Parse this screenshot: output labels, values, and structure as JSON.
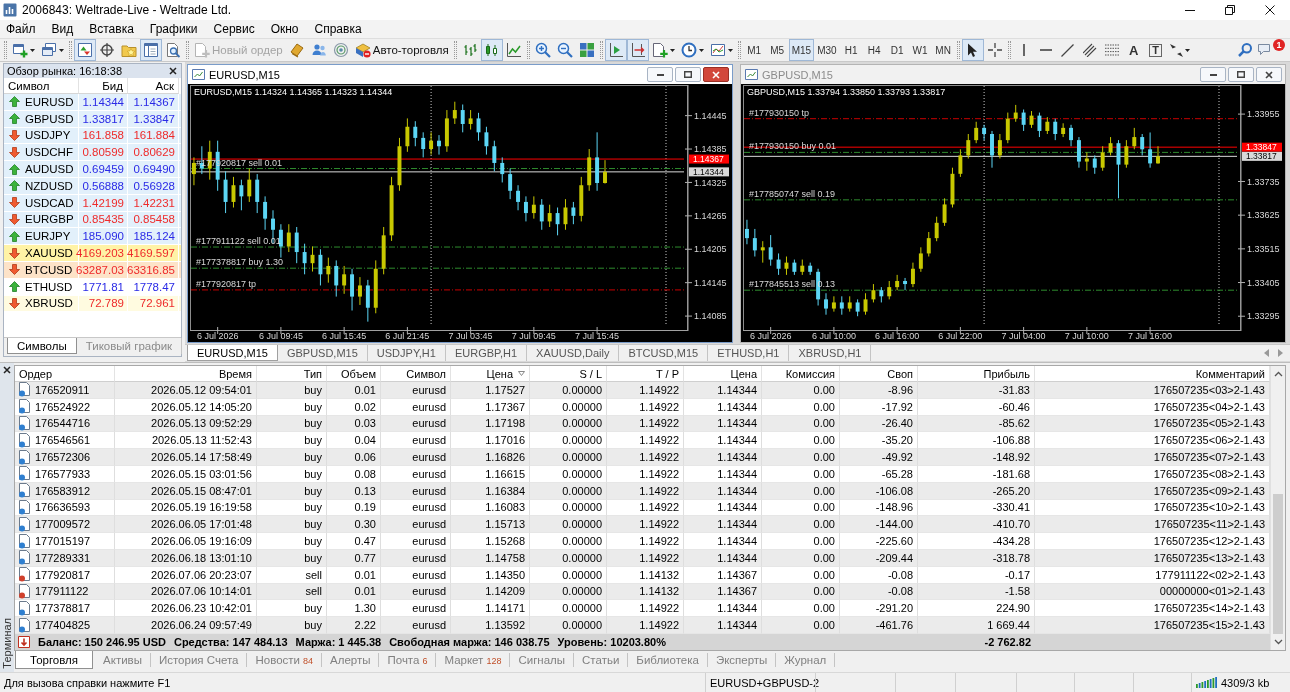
{
  "window": {
    "title": "2006843: Weltrade-Live - Weltrade Ltd."
  },
  "menu": [
    "Файл",
    "Вид",
    "Вставка",
    "Графики",
    "Сервис",
    "Окно",
    "Справка"
  ],
  "toolbar": {
    "panel_buttons": [
      {
        "pressed": true
      },
      {
        "pressed": false
      },
      {
        "pressed": false
      },
      {
        "pressed": true
      },
      {
        "pressed": false
      }
    ],
    "new_order": {
      "label": "Новый ордер",
      "disabled": true
    },
    "auto_trading": {
      "label": "Авто-торговля"
    },
    "chart_types": [
      {
        "selected": false
      },
      {
        "selected": true
      },
      {
        "selected": false
      }
    ],
    "chart_toggles": [
      {
        "pressed": true
      },
      {
        "pressed": true
      }
    ],
    "timeframes": [
      {
        "label": "M1",
        "selected": false
      },
      {
        "label": "M5",
        "selected": false
      },
      {
        "label": "M15",
        "selected": true
      },
      {
        "label": "M30",
        "selected": false
      },
      {
        "label": "H1",
        "selected": false
      },
      {
        "label": "H4",
        "selected": false
      },
      {
        "label": "D1",
        "selected": false
      },
      {
        "label": "W1",
        "selected": false
      },
      {
        "label": "MN",
        "selected": false
      }
    ],
    "cursor_tools": [
      {
        "selected": true
      },
      {
        "selected": false
      }
    ],
    "text_tools": [
      "A",
      "T"
    ],
    "notification_badge": "1"
  },
  "market_watch": {
    "title": "Обзор рынка: 16:18:38",
    "columns": [
      "Символ",
      "Бид",
      "Аск"
    ],
    "rows": [
      {
        "symbol": "EURUSD",
        "bid": "1.14344",
        "ask": "1.14367",
        "rising": true,
        "color": "#e2f0fb"
      },
      {
        "symbol": "GBPUSD",
        "bid": "1.33817",
        "ask": "1.33847",
        "rising": true,
        "color": "#e2f0fb"
      },
      {
        "symbol": "USDJPY",
        "bid": "161.858",
        "ask": "161.884",
        "rising": false,
        "color": "#e2f0fb"
      },
      {
        "symbol": "USDCHF",
        "bid": "0.80599",
        "ask": "0.80629",
        "rising": false,
        "color": "#e2f0fb"
      },
      {
        "symbol": "AUDUSD",
        "bid": "0.69459",
        "ask": "0.69490",
        "rising": true,
        "color": "#e2f0fb"
      },
      {
        "symbol": "NZDUSD",
        "bid": "0.56888",
        "ask": "0.56928",
        "rising": true,
        "color": "#e2f0fb"
      },
      {
        "symbol": "USDCAD",
        "bid": "1.42199",
        "ask": "1.42231",
        "rising": false,
        "color": "#e2f0fb"
      },
      {
        "symbol": "EURGBP",
        "bid": "0.85435",
        "ask": "0.85458",
        "rising": false,
        "color": "#e2f0fb"
      },
      {
        "symbol": "EURJPY",
        "bid": "185.090",
        "ask": "185.124",
        "rising": true,
        "color": "#e2f0fb"
      },
      {
        "symbol": "XAUUSD",
        "bid": "4169.203",
        "ask": "4169.597",
        "rising": false,
        "color": "#fff3a6"
      },
      {
        "symbol": "BTCUSD",
        "bid": "63287.03",
        "ask": "63316.85",
        "rising": false,
        "color": "#fde3c8"
      },
      {
        "symbol": "ETHUSD",
        "bid": "1771.81",
        "ask": "1778.47",
        "rising": true,
        "color": "#ffffff"
      },
      {
        "symbol": "XBRUSD",
        "bid": "72.789",
        "ask": "72.961",
        "rising": false,
        "color": "#fffbe0"
      }
    ],
    "tabs": [
      {
        "label": "Символы",
        "selected": true
      },
      {
        "label": "Тиковый график",
        "selected": false
      }
    ]
  },
  "charts": [
    {
      "title": "EURUSD,M15",
      "active": true,
      "chart_data": [
        {
          "type": "candlestick",
          "title": "EURUSD,M15 1.14324 1.14365 1.14323 1.14344",
          "categories": [
            null,
            null,
            null,
            "6 Jul 2026",
            null,
            null,
            null,
            null,
            null,
            null,
            null,
            "6 Jul 09:45",
            null,
            null,
            null,
            null,
            null,
            null,
            null,
            "6 Jul 15:45",
            null,
            null,
            null,
            null,
            null,
            null,
            null,
            "6 Jul 21:45",
            null,
            null,
            null,
            null,
            null,
            null,
            null,
            "7 Jul 03:45",
            null,
            null,
            null,
            null,
            null,
            null,
            null,
            "7 Jul 09:45",
            null,
            null,
            null,
            null,
            null,
            null,
            null,
            "7 Jul 15:45",
            null,
            null,
            null,
            null,
            null,
            null,
            null,
            null,
            null,
            null,
            null
          ],
          "ylim": [
            1.1406,
            1.145
          ],
          "yticks": [
            {
              "value": 1.14085,
              "label": "1.14085"
            },
            {
              "value": 1.14145,
              "label": "1.14145"
            },
            {
              "value": 1.14205,
              "label": "1.14205"
            },
            {
              "value": 1.14265,
              "label": "1.14265"
            },
            {
              "value": 1.14325,
              "label": "1.14325"
            },
            {
              "value": 1.14385,
              "label": "1.14385"
            },
            {
              "value": 1.14445,
              "label": "1.14445"
            }
          ],
          "ohlc": [
            [
              1.1434,
              1.1437,
              1.1432,
              1.1436
            ],
            [
              1.1436,
              1.1439,
              1.1434,
              1.1435
            ],
            [
              1.1435,
              1.144,
              1.1433,
              1.1438
            ],
            [
              1.1438,
              1.144,
              1.1431,
              1.1433
            ],
            [
              1.1433,
              1.14345,
              1.1427,
              1.1429
            ],
            [
              1.1429,
              1.14335,
              1.1428,
              1.1432
            ],
            [
              1.1432,
              1.1433,
              1.14275,
              1.143
            ],
            [
              1.143,
              1.1435,
              1.1429,
              1.1433
            ],
            [
              1.1433,
              1.1434,
              1.1427,
              1.1429
            ],
            [
              1.1429,
              1.143,
              1.1424,
              1.1426
            ],
            [
              1.1426,
              1.14275,
              1.14215,
              1.1424
            ],
            [
              1.1424,
              1.1425,
              1.1419,
              1.1421
            ],
            [
              1.1421,
              1.1425,
              1.142,
              1.14235
            ],
            [
              1.14235,
              1.14245,
              1.1418,
              1.142
            ],
            [
              1.142,
              1.14215,
              1.1416,
              1.1418
            ],
            [
              1.1418,
              1.1421,
              1.14165,
              1.14195
            ],
            [
              1.14195,
              1.14205,
              1.1414,
              1.1416
            ],
            [
              1.1416,
              1.1419,
              1.14145,
              1.14175
            ],
            [
              1.14175,
              1.14185,
              1.1412,
              1.1414
            ],
            [
              1.1414,
              1.14175,
              1.14125,
              1.1416
            ],
            [
              1.1416,
              1.1417,
              1.14095,
              1.1412
            ],
            [
              1.1412,
              1.14155,
              1.14105,
              1.1414
            ],
            [
              1.1414,
              1.1415,
              1.14075,
              1.141
            ],
            [
              1.141,
              1.14185,
              1.1409,
              1.1417
            ],
            [
              1.1417,
              1.14245,
              1.1416,
              1.1423
            ],
            [
              1.1423,
              1.14335,
              1.1422,
              1.1432
            ],
            [
              1.1432,
              1.14405,
              1.1431,
              1.1439
            ],
            [
              1.1439,
              1.1444,
              1.1438,
              1.14425
            ],
            [
              1.14425,
              1.14435,
              1.1439,
              1.14405
            ],
            [
              1.14405,
              1.14415,
              1.1437,
              1.14385
            ],
            [
              1.14385,
              1.14415,
              1.14375,
              1.144
            ],
            [
              1.144,
              1.1441,
              1.14375,
              1.1439
            ],
            [
              1.1439,
              1.14455,
              1.1438,
              1.1444
            ],
            [
              1.1444,
              1.1447,
              1.1443,
              1.14455
            ],
            [
              1.14455,
              1.14465,
              1.14415,
              1.1443
            ],
            [
              1.1443,
              1.14455,
              1.1442,
              1.1444
            ],
            [
              1.1444,
              1.1445,
              1.144,
              1.14415
            ],
            [
              1.14415,
              1.14425,
              1.14375,
              1.1439
            ],
            [
              1.1439,
              1.144,
              1.14345,
              1.1436
            ],
            [
              1.1436,
              1.1437,
              1.14325,
              1.1434
            ],
            [
              1.1434,
              1.1435,
              1.14295,
              1.1431
            ],
            [
              1.1431,
              1.1432,
              1.14275,
              1.1429
            ],
            [
              1.1429,
              1.143,
              1.14255,
              1.1427
            ],
            [
              1.1427,
              1.143,
              1.1426,
              1.14285
            ],
            [
              1.14285,
              1.14295,
              1.1424,
              1.14255
            ],
            [
              1.14255,
              1.14285,
              1.14245,
              1.1427
            ],
            [
              1.1427,
              1.1428,
              1.1423,
              1.1425
            ],
            [
              1.1425,
              1.14295,
              1.1424,
              1.1428
            ],
            [
              1.1428,
              1.1429,
              1.1425,
              1.14265
            ],
            [
              1.14265,
              1.14335,
              1.14255,
              1.1432
            ],
            [
              1.1432,
              1.14385,
              1.1431,
              1.1437
            ],
            [
              1.1437,
              1.14415,
              1.1431,
              1.14324
            ],
            [
              1.14324,
              1.14365,
              1.14323,
              1.14344
            ],
            null,
            null,
            null,
            null,
            null,
            null,
            null,
            null,
            null,
            null
          ],
          "ref_lines": [
            {
              "axis": "y",
              "value": 1.14367,
              "label": "1.14367",
              "color": "#ff0000",
              "line_style": "solid"
            },
            {
              "axis": "y",
              "value": 1.14344,
              "label": "1.14344",
              "color": "#d9d9d9",
              "line_style": "solid"
            },
            {
              "axis": "y",
              "value": 1.1435,
              "label": "#177920817 sell 0.01",
              "color": "#2e8b2e",
              "line_style": "dashdot"
            },
            {
              "axis": "y",
              "value": 1.14209,
              "label": "#177911122 sell 0.01",
              "color": "#2e8b2e",
              "line_style": "dashdot"
            },
            {
              "axis": "y",
              "value": 1.14171,
              "label": "#177378817 buy 1.30",
              "color": "#2e8b2e",
              "line_style": "dashdot"
            },
            {
              "axis": "y",
              "value": 1.14132,
              "label": "#177920817 tp",
              "color": "#c80000",
              "line_style": "dashdot"
            }
          ]
        }
      ]
    },
    {
      "title": "GBPUSD,M15",
      "active": false,
      "chart_data": [
        {
          "type": "candlestick",
          "title": "GBPUSD,M15 1.33794 1.33850 1.33793 1.33817",
          "categories": [
            null,
            null,
            null,
            "6 Jul 2026",
            null,
            null,
            null,
            null,
            null,
            null,
            null,
            "6 Jul 10:00",
            null,
            null,
            null,
            null,
            null,
            null,
            null,
            "6 Jul 16:00",
            null,
            null,
            null,
            null,
            null,
            null,
            null,
            "6 Jul 22:00",
            null,
            null,
            null,
            null,
            null,
            null,
            null,
            "7 Jul 04:00",
            null,
            null,
            null,
            null,
            null,
            null,
            null,
            "7 Jul 10:00",
            null,
            null,
            null,
            null,
            null,
            null,
            null,
            "7 Jul 16:00",
            null,
            null,
            null,
            null,
            null,
            null,
            null,
            null,
            null,
            null,
            null
          ],
          "ylim": [
            1.3325,
            1.3405
          ],
          "yticks": [
            {
              "value": 1.33295,
              "label": "1.33295"
            },
            {
              "value": 1.33405,
              "label": "1.33405"
            },
            {
              "value": 1.33515,
              "label": "1.33515"
            },
            {
              "value": 1.33625,
              "label": "1.33625"
            },
            {
              "value": 1.33735,
              "label": "1.33735"
            },
            {
              "value": 1.33955,
              "label": "1.33955"
            }
          ],
          "ohlc": [
            [
              1.3358,
              1.3361,
              1.3353,
              1.3355
            ],
            [
              1.3355,
              1.3358,
              1.3349,
              1.3351
            ],
            [
              1.3351,
              1.3354,
              1.3347,
              1.3352
            ],
            [
              1.3352,
              1.3356,
              1.3346,
              1.3348
            ],
            [
              1.3348,
              1.335,
              1.3343,
              1.3345
            ],
            [
              1.3345,
              1.3349,
              1.3343,
              1.3347
            ],
            [
              1.3347,
              1.3348,
              1.3343,
              1.3344
            ],
            [
              1.3344,
              1.3348,
              1.3343,
              1.3346
            ],
            [
              1.3346,
              1.3347,
              1.3343,
              1.3344
            ],
            [
              1.3344,
              1.3345,
              1.3333,
              1.3335
            ],
            [
              1.3335,
              1.3337,
              1.333,
              1.3332
            ],
            [
              1.3332,
              1.3336,
              1.3331,
              1.3334
            ],
            [
              1.3334,
              1.3336,
              1.333,
              1.3332
            ],
            [
              1.3332,
              1.3336,
              1.3331,
              1.3334
            ],
            [
              1.3334,
              1.3335,
              1.33295,
              1.3331
            ],
            [
              1.3331,
              1.3337,
              1.333,
              1.3335
            ],
            [
              1.3335,
              1.334,
              1.3334,
              1.3338
            ],
            [
              1.3338,
              1.3339,
              1.3334,
              1.3336
            ],
            [
              1.3336,
              1.3341,
              1.3335,
              1.3339
            ],
            [
              1.3339,
              1.3343,
              1.3338,
              1.3341
            ],
            [
              1.3341,
              1.3342,
              1.3338,
              1.334
            ],
            [
              1.334,
              1.3347,
              1.3339,
              1.3345
            ],
            [
              1.3345,
              1.3352,
              1.3344,
              1.335
            ],
            [
              1.335,
              1.3357,
              1.3349,
              1.3355
            ],
            [
              1.3355,
              1.3362,
              1.3354,
              1.336
            ],
            [
              1.336,
              1.3368,
              1.3359,
              1.3366
            ],
            [
              1.3366,
              1.3378,
              1.3365,
              1.3376
            ],
            [
              1.3376,
              1.3384,
              1.3375,
              1.3382
            ],
            [
              1.3382,
              1.3389,
              1.3381,
              1.3387
            ],
            [
              1.3387,
              1.3393,
              1.3386,
              1.3391
            ],
            [
              1.3391,
              1.3392,
              1.3387,
              1.3389
            ],
            [
              1.3389,
              1.339,
              1.3378,
              1.3382
            ],
            [
              1.3382,
              1.3389,
              1.3381,
              1.3387
            ],
            [
              1.3387,
              1.3396,
              1.3386,
              1.3394
            ],
            [
              1.3394,
              1.33985,
              1.3393,
              1.3396
            ],
            [
              1.3396,
              1.3397,
              1.339,
              1.3392
            ],
            [
              1.3392,
              1.33965,
              1.3391,
              1.3395
            ],
            [
              1.3395,
              1.3396,
              1.3388,
              1.339
            ],
            [
              1.339,
              1.33945,
              1.3389,
              1.3393
            ],
            [
              1.3393,
              1.3394,
              1.3387,
              1.3389
            ],
            [
              1.3389,
              1.33925,
              1.3388,
              1.3391
            ],
            [
              1.3391,
              1.3392,
              1.3385,
              1.3387
            ],
            [
              1.3387,
              1.3388,
              1.3378,
              1.338
            ],
            [
              1.338,
              1.3383,
              1.3377,
              1.3381
            ],
            [
              1.3381,
              1.3382,
              1.3376,
              1.3378
            ],
            [
              1.3378,
              1.3385,
              1.3377,
              1.3383
            ],
            [
              1.3383,
              1.3388,
              1.3382,
              1.3386
            ],
            [
              1.3386,
              1.3387,
              1.3368,
              1.3379
            ],
            [
              1.3379,
              1.3387,
              1.3378,
              1.3385
            ],
            [
              1.3385,
              1.3391,
              1.3384,
              1.3388
            ],
            [
              1.3388,
              1.3389,
              1.3382,
              1.3384
            ],
            [
              1.3384,
              1.33895,
              1.3378,
              1.33794
            ],
            [
              1.33794,
              1.3385,
              1.33793,
              1.33817
            ],
            null,
            null,
            null,
            null,
            null,
            null,
            null,
            null,
            null,
            null
          ],
          "ref_lines": [
            {
              "axis": "y",
              "value": 1.33847,
              "label": "1.33847",
              "color": "#ff0000",
              "line_style": "solid"
            },
            {
              "axis": "y",
              "value": 1.33817,
              "label": "1.33817",
              "color": "#d9d9d9",
              "line_style": "solid"
            },
            {
              "axis": "y",
              "value": 1.3394,
              "label": "#177930150 tp",
              "color": "#c80000",
              "line_style": "dashdot"
            },
            {
              "axis": "y",
              "value": 1.3383,
              "label": "#177930150 buy 0.01",
              "color": "#2e8b2e",
              "line_style": "dashdot"
            },
            {
              "axis": "y",
              "value": 1.33675,
              "label": "#177850747 sell 0.19",
              "color": "#2e8b2e",
              "line_style": "dashdot"
            },
            {
              "axis": "y",
              "value": 1.3338,
              "label": "#177845513 sell 0.13",
              "color": "#2e8b2e",
              "line_style": "dashdot"
            }
          ]
        }
      ]
    }
  ],
  "chart_tabs": [
    {
      "label": "EURUSD,M15",
      "selected": true
    },
    {
      "label": "GBPUSD,M15",
      "selected": false
    },
    {
      "label": "USDJPY,H1",
      "selected": false
    },
    {
      "label": "EURGBP,H1",
      "selected": false
    },
    {
      "label": "XAUUSD,Daily",
      "selected": false
    },
    {
      "label": "BTCUSD,M15",
      "selected": false
    },
    {
      "label": "ETHUSD,H1",
      "selected": false
    },
    {
      "label": "XBRUSD,H1",
      "selected": false
    }
  ],
  "terminal": {
    "side_label": "Терминал",
    "columns": [
      {
        "label": "Ордер",
        "sorted": false
      },
      {
        "label": "Время",
        "sorted": false
      },
      {
        "label": "Тип",
        "sorted": false
      },
      {
        "label": "Объем",
        "sorted": false
      },
      {
        "label": "Символ",
        "sorted": false
      },
      {
        "label": "Цена",
        "sorted": true
      },
      {
        "label": "S / L",
        "sorted": false
      },
      {
        "label": "T / P",
        "sorted": false
      },
      {
        "label": "Цена",
        "sorted": false
      },
      {
        "label": "Комиссия",
        "sorted": false
      },
      {
        "label": "Своп",
        "sorted": false
      },
      {
        "label": "Прибыль",
        "sorted": false
      },
      {
        "label": "Комментарий",
        "sorted": false
      }
    ],
    "rows": [
      {
        "kind": "buy",
        "cells": [
          "176520911",
          "2026.05.12 09:54:01",
          "buy",
          "0.01",
          "eurusd",
          "1.17527",
          "0.00000",
          "1.14922",
          "1.14344",
          "0.00",
          "-8.96",
          "-31.83",
          "176507235<03>2-1.43"
        ]
      },
      {
        "kind": "buy",
        "cells": [
          "176524922",
          "2026.05.12 14:05:20",
          "buy",
          "0.02",
          "eurusd",
          "1.17367",
          "0.00000",
          "1.14922",
          "1.14344",
          "0.00",
          "-17.92",
          "-60.46",
          "176507235<04>2-1.43"
        ]
      },
      {
        "kind": "buy",
        "cells": [
          "176544716",
          "2026.05.13 09:52:29",
          "buy",
          "0.03",
          "eurusd",
          "1.17198",
          "0.00000",
          "1.14922",
          "1.14344",
          "0.00",
          "-26.40",
          "-85.62",
          "176507235<05>2-1.43"
        ]
      },
      {
        "kind": "buy",
        "cells": [
          "176546561",
          "2026.05.13 11:52:43",
          "buy",
          "0.04",
          "eurusd",
          "1.17016",
          "0.00000",
          "1.14922",
          "1.14344",
          "0.00",
          "-35.20",
          "-106.88",
          "176507235<06>2-1.43"
        ]
      },
      {
        "kind": "buy",
        "cells": [
          "176572306",
          "2026.05.14 17:58:49",
          "buy",
          "0.06",
          "eurusd",
          "1.16826",
          "0.00000",
          "1.14922",
          "1.14344",
          "0.00",
          "-49.92",
          "-148.92",
          "176507235<07>2-1.43"
        ]
      },
      {
        "kind": "buy",
        "cells": [
          "176577933",
          "2026.05.15 03:01:56",
          "buy",
          "0.08",
          "eurusd",
          "1.16615",
          "0.00000",
          "1.14922",
          "1.14344",
          "0.00",
          "-65.28",
          "-181.68",
          "176507235<08>2-1.43"
        ]
      },
      {
        "kind": "buy",
        "cells": [
          "176583912",
          "2026.05.15 08:47:01",
          "buy",
          "0.13",
          "eurusd",
          "1.16384",
          "0.00000",
          "1.14922",
          "1.14344",
          "0.00",
          "-106.08",
          "-265.20",
          "176507235<09>2-1.43"
        ]
      },
      {
        "kind": "buy",
        "cells": [
          "176636593",
          "2026.05.19 16:19:58",
          "buy",
          "0.19",
          "eurusd",
          "1.16083",
          "0.00000",
          "1.14922",
          "1.14344",
          "0.00",
          "-148.96",
          "-330.41",
          "176507235<10>2-1.43"
        ]
      },
      {
        "kind": "buy",
        "cells": [
          "177009572",
          "2026.06.05 17:01:48",
          "buy",
          "0.30",
          "eurusd",
          "1.15713",
          "0.00000",
          "1.14922",
          "1.14344",
          "0.00",
          "-144.00",
          "-410.70",
          "176507235<11>2-1.43"
        ]
      },
      {
        "kind": "buy",
        "cells": [
          "177015197",
          "2026.06.05 19:16:09",
          "buy",
          "0.47",
          "eurusd",
          "1.15268",
          "0.00000",
          "1.14922",
          "1.14344",
          "0.00",
          "-225.60",
          "-434.28",
          "176507235<12>2-1.43"
        ]
      },
      {
        "kind": "buy",
        "cells": [
          "177289331",
          "2026.06.18 13:01:10",
          "buy",
          "0.77",
          "eurusd",
          "1.14758",
          "0.00000",
          "1.14922",
          "1.14344",
          "0.00",
          "-209.44",
          "-318.78",
          "176507235<13>2-1.43"
        ]
      },
      {
        "kind": "sell",
        "cells": [
          "177920817",
          "2026.07.06 20:23:07",
          "sell",
          "0.01",
          "eurusd",
          "1.14350",
          "0.00000",
          "1.14132",
          "1.14367",
          "0.00",
          "-0.08",
          "-0.17",
          "177911122<02>2-1.43"
        ]
      },
      {
        "kind": "sell",
        "cells": [
          "177911122",
          "2026.07.06 10:14:01",
          "sell",
          "0.01",
          "eurusd",
          "1.14209",
          "0.00000",
          "1.14132",
          "1.14367",
          "0.00",
          "-0.08",
          "-1.58",
          "00000000<01>2-1.43"
        ]
      },
      {
        "kind": "buy",
        "cells": [
          "177378817",
          "2026.06.23 10:42:01",
          "buy",
          "1.30",
          "eurusd",
          "1.14171",
          "0.00000",
          "1.14922",
          "1.14344",
          "0.00",
          "-291.20",
          "224.90",
          "176507235<14>2-1.43"
        ]
      },
      {
        "kind": "buy",
        "cells": [
          "177404825",
          "2026.06.24 09:57:49",
          "buy",
          "2.22",
          "eurusd",
          "1.13592",
          "0.00000",
          "1.14922",
          "1.14344",
          "0.00",
          "-461.76",
          "1 669.44",
          "176507235<15>2-1.43"
        ]
      }
    ],
    "summary": {
      "items": [
        "Баланс: 150 246.95 USD",
        "Средства: 147 484.13",
        "Маржа: 1 445.38",
        "Свободная маржа: 146 038.75",
        "Уровень: 10203.80%"
      ],
      "profit": "-2 762.82"
    },
    "tabs": [
      {
        "label": "Торговля",
        "selected": true
      },
      {
        "label": "Активы",
        "selected": false
      },
      {
        "label": "История Счета",
        "selected": false
      },
      {
        "label": "Новости",
        "badge": "84",
        "selected": false
      },
      {
        "label": "Алерты",
        "selected": false
      },
      {
        "label": "Почта",
        "badge": "6",
        "selected": false
      },
      {
        "label": "Маркет",
        "badge": "128",
        "selected": false
      },
      {
        "label": "Сигналы",
        "selected": false
      },
      {
        "label": "Статьи",
        "selected": false
      },
      {
        "label": "Библиотека",
        "selected": false
      },
      {
        "label": "Эксперты",
        "selected": false
      },
      {
        "label": "Журнал",
        "selected": false
      }
    ]
  },
  "status_bar": {
    "help": "Для вызова справки нажмите F1",
    "profile": "EURUSD+GBPUSD-2",
    "traffic": "4309/3 kb"
  }
}
